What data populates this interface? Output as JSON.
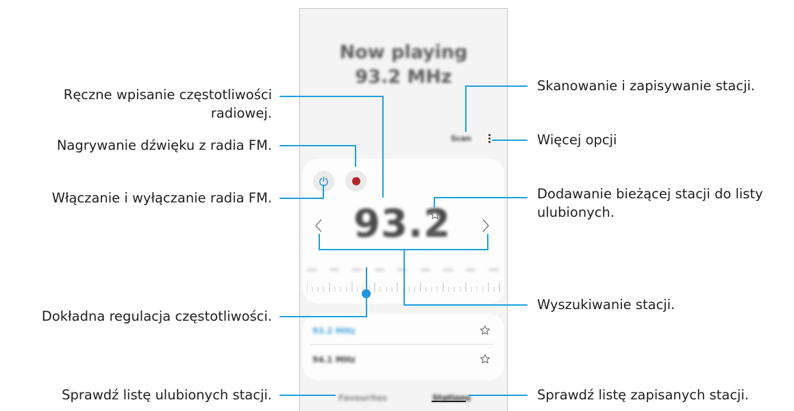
{
  "phone": {
    "now_playing_line1": "Now playing",
    "now_playing_line2": "93.2 MHz",
    "scan_label": "Scan",
    "frequency": "93.2",
    "frequency_unit": "MHz",
    "stations": [
      {
        "name": "93.2 MHz",
        "active": true
      },
      {
        "name": "94.1 MHz",
        "active": false
      }
    ],
    "tabs": {
      "favourites": "Favourites",
      "stations": "Stations"
    },
    "accent_color": "#1f94d6",
    "record_color": "#b3262b"
  },
  "callouts": {
    "manual_frequency_1": "Ręczne wpisanie częstotliwości",
    "manual_frequency_2": "radiowej.",
    "record": "Nagrywanie dźwięku z radia FM.",
    "power": "Włączanie i wyłączanie radia FM.",
    "fine_tune": "Dokładna regulacja częstotliwości.",
    "check_favourites": "Sprawdź listę ulubionych stacji.",
    "scan_save": "Skanowanie i zapisywanie stacji.",
    "more_options": "Więcej opcji",
    "add_favourite_1": "Dodawanie bieżącej stacji do listy",
    "add_favourite_2": "ulubionych.",
    "search_station": "Wyszukiwanie stacji.",
    "check_saved": "Sprawdź listę zapisanych stacji."
  }
}
